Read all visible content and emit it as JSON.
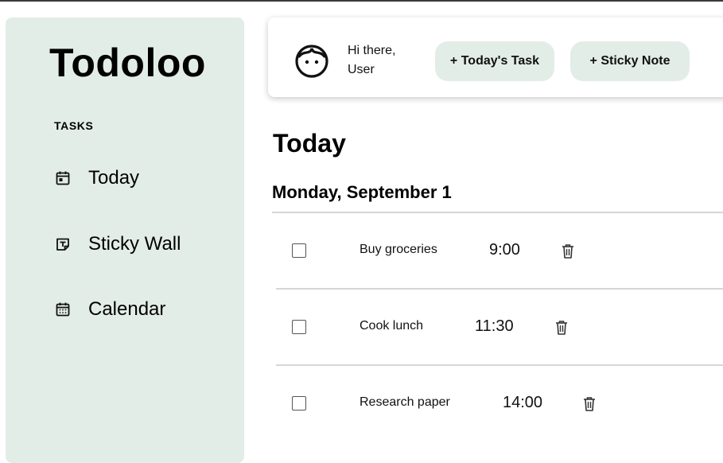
{
  "app": {
    "name": "Todoloo"
  },
  "sidebar": {
    "section_title": "TASKS",
    "items": [
      {
        "label": "Today",
        "icon": "calendar-day-icon"
      },
      {
        "label": "Sticky Wall",
        "icon": "sticky-note-icon"
      },
      {
        "label": "Calendar",
        "icon": "calendar-grid-icon"
      }
    ]
  },
  "header": {
    "avatar_icon": "face-icon",
    "greeting_line1": "Hi there,",
    "greeting_line2": "User",
    "add_task_label": "+ Today's Task",
    "add_sticky_label": "+ Sticky Note"
  },
  "main": {
    "title": "Today",
    "date": "Monday, September 1",
    "tasks": [
      {
        "name": "Buy groceries",
        "time": "9:00",
        "done": false
      },
      {
        "name": "Cook lunch",
        "time": "11:30",
        "done": false
      },
      {
        "name": "Research paper",
        "time": "14:00",
        "done": false
      }
    ]
  },
  "colors": {
    "accent": "#e3ede8",
    "divider": "#d6d6d6",
    "text": "#000000"
  }
}
